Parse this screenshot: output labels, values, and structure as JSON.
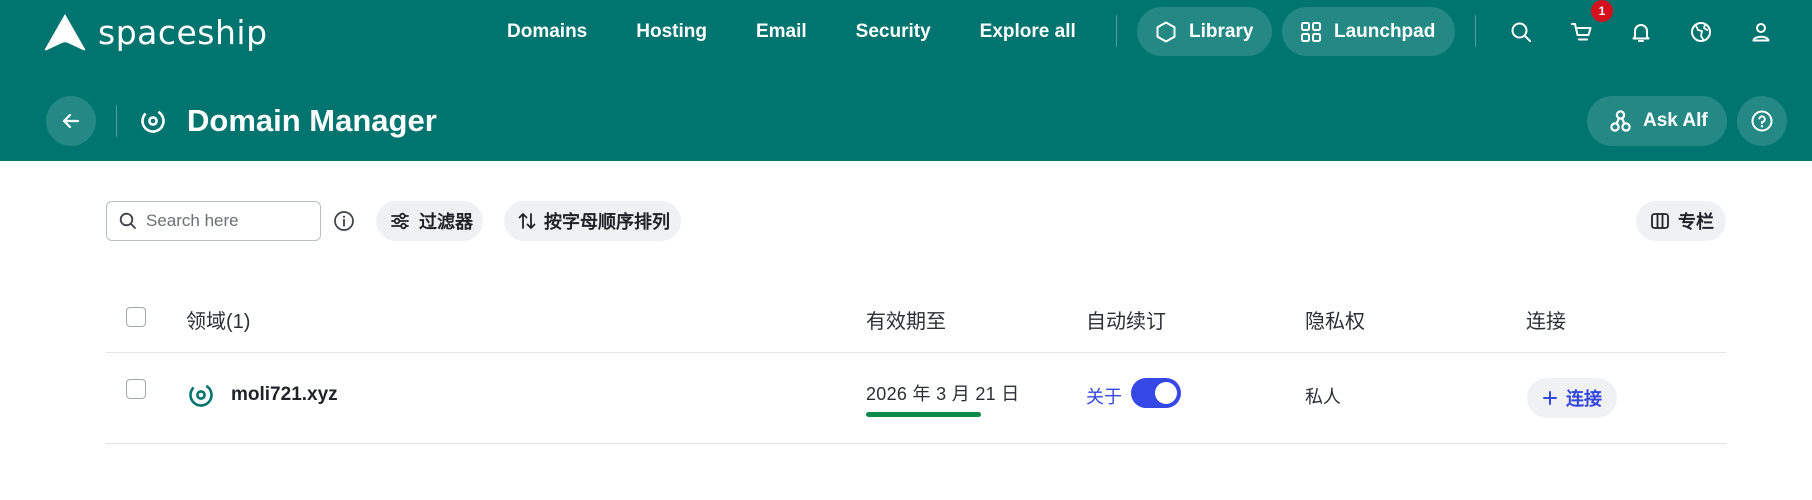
{
  "brand": {
    "name": "spaceship"
  },
  "topnav": {
    "items": [
      {
        "label": "Domains"
      },
      {
        "label": "Hosting"
      },
      {
        "label": "Email"
      },
      {
        "label": "Security"
      },
      {
        "label": "Explore all"
      }
    ],
    "library_label": "Library",
    "launchpad_label": "Launchpad",
    "cart_count": "1"
  },
  "page_header": {
    "title": "Domain Manager",
    "ask_label": "Ask Alf"
  },
  "toolbar": {
    "search_placeholder": "Search here",
    "filter_label": "过滤器",
    "sort_label": "按字母顺序排列",
    "columns_label": "专栏"
  },
  "table": {
    "headers": {
      "domain": "领域(1)",
      "expires": "有效期至",
      "autorenew": "自动续订",
      "privacy": "隐私权",
      "connect": "连接"
    },
    "rows": [
      {
        "domain": "moli721.xyz",
        "expires": "2026 年 3 月 21 日",
        "autorenew_label": "关于",
        "autorenew_on": true,
        "privacy": "私人",
        "connect_label": "连接"
      }
    ]
  },
  "colors": {
    "header_bg": "#007570",
    "accent_blue": "#3547e5",
    "expiry_bar": "#0c8a4a",
    "badge_red": "#d4101e"
  }
}
